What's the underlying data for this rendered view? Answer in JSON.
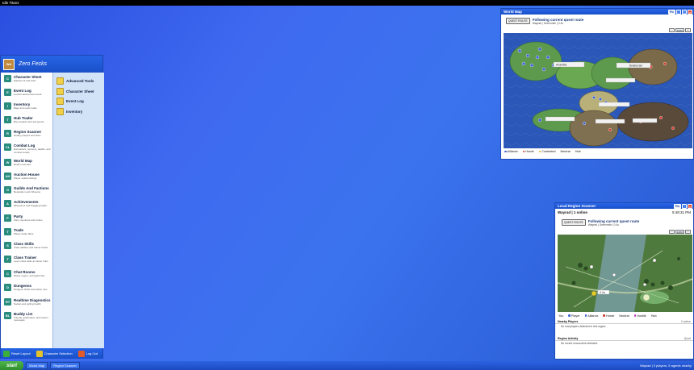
{
  "app_title": "Idle Titans",
  "start_menu": {
    "avatar_text": "WA",
    "user_name": "Zero Fecks",
    "items": [
      {
        "icon": "C",
        "label": "Character Sheet",
        "desc": "Equipment and stats",
        "color": "#2a8c7e"
      },
      {
        "icon": "E",
        "label": "Event Log",
        "desc": "Current autonomous work",
        "color": "#2a8c7e"
      },
      {
        "icon": "I",
        "label": "Inventory",
        "desc": "Bags and useful stats",
        "color": "#2a8c7e"
      },
      {
        "icon": "T",
        "label": "Hub Trader",
        "desc": "Buy supplies and sell goods",
        "color": "#2a8c7e"
      },
      {
        "icon": "R",
        "label": "Region Scanner",
        "desc": "Nearby players and hubs",
        "color": "#2a8c7e"
      },
      {
        "icon": "CL",
        "label": "Combat Log",
        "desc": "Encounters, recovery, deaths, and combat results",
        "color": "#2a8c7e"
      },
      {
        "icon": "W",
        "label": "World Map",
        "desc": "Realm overview",
        "color": "#2a8c7e"
      },
      {
        "icon": "AH",
        "label": "Auction House",
        "desc": "Player market listings",
        "color": "#2a8c7e"
      },
      {
        "icon": "G",
        "label": "Guilds And Factions",
        "desc": "Reputation and influence",
        "color": "#2a8c7e"
      },
      {
        "icon": "A",
        "label": "Achievements",
        "desc": "Milestones and bragging rights",
        "color": "#2a8c7e"
      },
      {
        "icon": "P",
        "label": "Party",
        "desc": "Party members and invites",
        "color": "#2a8c7e"
      },
      {
        "icon": "T",
        "label": "Trade",
        "desc": "Player trade offers",
        "color": "#2a8c7e"
      },
      {
        "icon": "S",
        "label": "Class Skills",
        "desc": "Class abilities and trainer books",
        "color": "#2a8c7e"
      },
      {
        "icon": "T",
        "label": "Class Trainer",
        "desc": "Learn class skills at trainer hubs",
        "color": "#2a8c7e"
      },
      {
        "icon": "C",
        "label": "Chat Rooms",
        "desc": "World, region, and guild chat",
        "color": "#2a8c7e"
      },
      {
        "icon": "D",
        "label": "Dungeons",
        "desc": "Dungeon finder and active runs",
        "color": "#2a8c7e"
      },
      {
        "icon": "RT",
        "label": "Realtime Diagnostics",
        "desc": "Socket and polling health",
        "color": "#2a8c7e"
      },
      {
        "icon": "BL",
        "label": "Buddy List",
        "desc": "Friends, guildmates, and instant messages",
        "color": "#2a8c7e"
      }
    ],
    "right_items": [
      "Advanced Tools",
      "Character Sheet",
      "Event Log",
      "Inventory"
    ],
    "footer": [
      {
        "label": "Reset Layout",
        "color": "#3cae3a"
      },
      {
        "label": "Character Selection",
        "color": "#e6c32a"
      },
      {
        "label": "Log Out",
        "color": "#e05a2a"
      }
    ]
  },
  "world_map": {
    "title": "World Map",
    "pin_label": "Pin",
    "quest_button": "QUEST ROUTE",
    "quest_title": "Following current quest route",
    "quest_sub": "Wayrad | Greenmile | 0.4u",
    "zoom": "100%",
    "zone_labels": [
      "Aravilla",
      "Brakeran"
    ],
    "legend": [
      {
        "label": "Alliance",
        "color": "#3a5fd0"
      },
      {
        "label": "Horde",
        "color": "#d03a2a"
      },
      {
        "label": "Contested",
        "color": "#d8b020"
      },
      {
        "label": "Neutral",
        "color": ""
      },
      {
        "label": "Hub",
        "color": ""
      }
    ]
  },
  "scanner": {
    "title": "Local Region Scanner",
    "pin_label": "Pin",
    "status": "Wayrad | 1 online",
    "time": "5:48:31 PM",
    "quest_button": "QUEST ROUTE",
    "quest_title": "Following current quest route",
    "quest_sub": "Wayrad | Greenmile | 0.4u",
    "zoom": "100%",
    "player_tag": "0.4u",
    "legend": [
      {
        "label": "You",
        "color": ""
      },
      {
        "label": "Player",
        "color": "#3a5fd0"
      },
      {
        "label": "Alliance",
        "color": "#3a5fd0"
      },
      {
        "label": "Horde",
        "color": "#d03a2a"
      },
      {
        "label": "Neutral",
        "color": ""
      },
      {
        "label": "Hostile",
        "color": "#c03ac0"
      },
      {
        "label": "Hub",
        "color": ""
      }
    ],
    "nearby_heading": "Nearby Players",
    "nearby_count": "0 active",
    "nearby_msg": "No real players detected in this region.",
    "activity_heading": "Region Activity",
    "activity_status": "Quiet",
    "activity_msg": "No recent encounters detected."
  },
  "taskbar": {
    "start_label": "start",
    "buttons": [
      "World Map",
      "Region Scanner"
    ],
    "status": "Wayrad | 0 players, 5 agents nearby"
  }
}
